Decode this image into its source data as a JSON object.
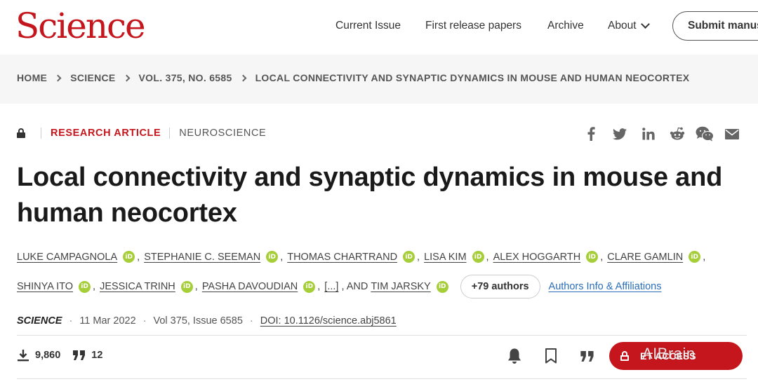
{
  "header": {
    "logo": "Science",
    "nav": {
      "current_issue": "Current Issue",
      "first_release": "First release papers",
      "archive": "Archive",
      "about": "About"
    },
    "submit_label": "Submit manus"
  },
  "breadcrumb": [
    "HOME",
    "SCIENCE",
    "VOL. 375, NO. 6585",
    "LOCAL CONNECTIVITY AND SYNAPTIC DYNAMICS IN MOUSE AND HUMAN NEOCORTEX"
  ],
  "article": {
    "type": "RESEARCH ARTICLE",
    "section": "NEUROSCIENCE",
    "title": "Local connectivity and synaptic dynamics in mouse and human neocortex",
    "authors_line1": [
      "LUKE CAMPAGNOLA",
      "STEPHANIE C. SEEMAN",
      "THOMAS CHARTRAND",
      "LISA KIM",
      "ALEX HOGGARTH",
      "CLARE GAMLIN"
    ],
    "authors_line2": [
      "SHINYA ITO",
      "JESSICA TRINH",
      "PASHA DAVOUDIAN"
    ],
    "ellipsis": "[...]",
    "and_text": ", AND",
    "last_author": "TIM JARSKY",
    "orcid_label": "iD",
    "more_authors": "+79 authors",
    "affiliations_link": "Authors Info & Affiliations",
    "journal": "SCIENCE",
    "date": "11 Mar 2022",
    "volume": "Vol 375, Issue 6585",
    "doi": "DOI: 10.1126/science.abj5861"
  },
  "metrics": {
    "downloads": "9,860",
    "citations": "12"
  },
  "access_button": {
    "label": "ET ACCESS",
    "watermark": "AIBrain"
  },
  "icons": {
    "lock": "lock-icon",
    "facebook": "facebook-icon",
    "twitter": "twitter-icon",
    "linkedin": "linkedin-icon",
    "reddit": "reddit-icon",
    "wechat": "wechat-icon",
    "email": "email-icon",
    "download": "download-icon",
    "quote": "quote-icon",
    "bell": "bell-icon",
    "bookmark": "bookmark-icon"
  },
  "colors": {
    "brand_red": "#c4161c",
    "orcid_green": "#a6ce39",
    "link_blue": "#2a6ebb"
  }
}
